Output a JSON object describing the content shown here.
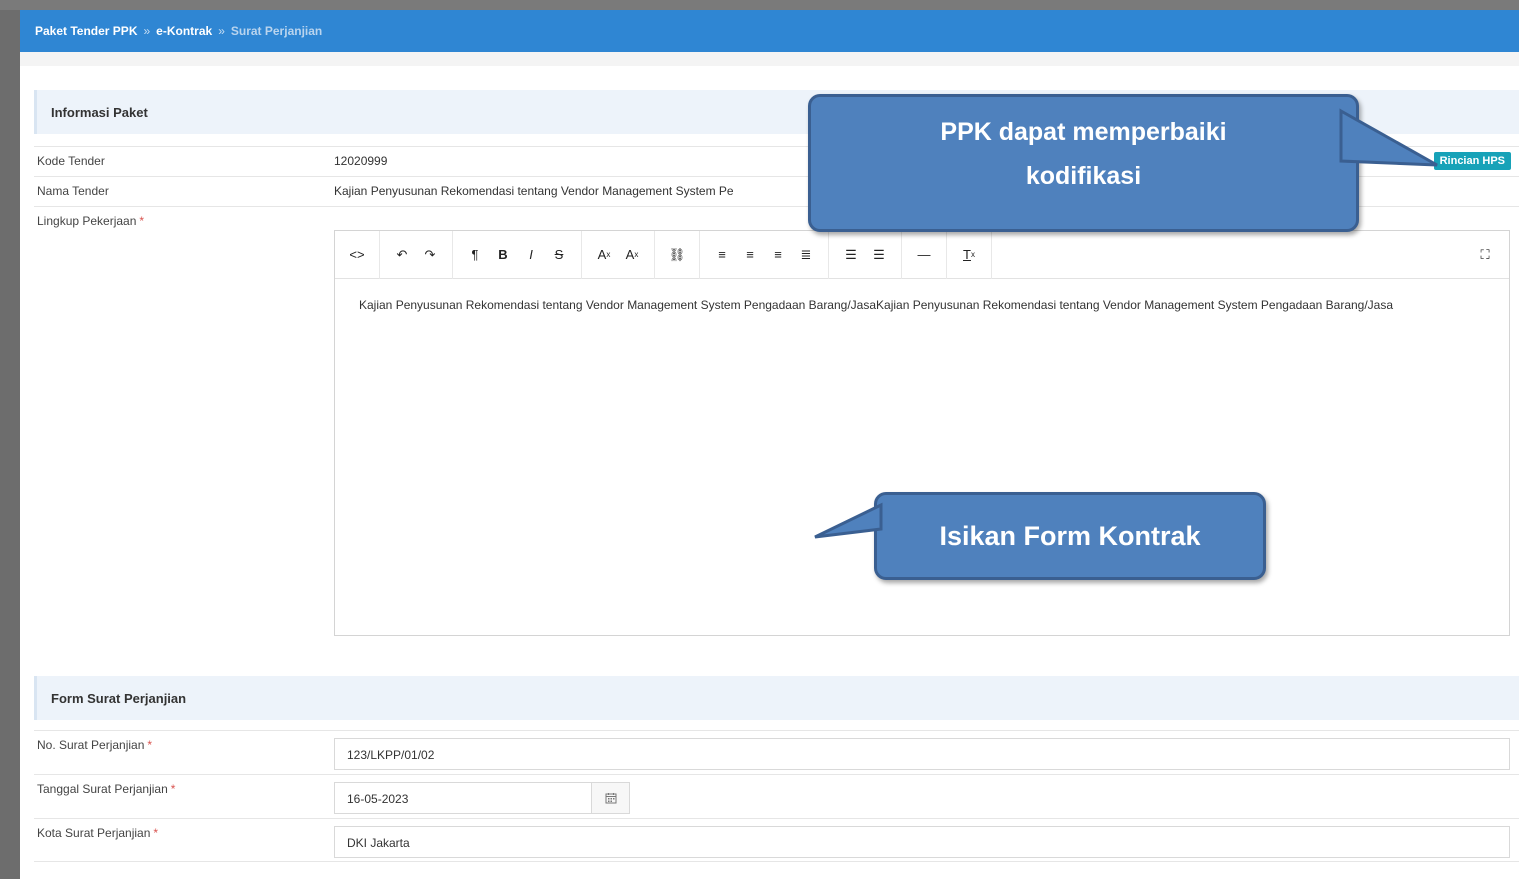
{
  "breadcrumb": {
    "item1": "Paket Tender PPK",
    "separator": "»",
    "item2": "e-Kontrak",
    "current": "Surat Perjanjian"
  },
  "informasi_paket": {
    "title": "Informasi Paket",
    "kode_tender_label": "Kode Tender",
    "kode_tender_value": "12020999",
    "rincian_hps_label": "Rincian HPS",
    "nama_tender_label": "Nama Tender",
    "nama_tender_value": "Kajian Penyusunan Rekomendasi tentang Vendor Management System Pe",
    "lingkup_label": "Lingkup Pekerjaan",
    "required_mark": "*"
  },
  "editor": {
    "toolbar_icons": [
      "html-code-icon",
      "undo-icon",
      "redo-icon",
      "paragraph-icon",
      "bold-icon",
      "italic-icon",
      "strikethrough-icon",
      "superscript-icon",
      "subscript-icon",
      "link-icon",
      "align-left-icon",
      "align-center-icon",
      "align-right-icon",
      "align-justify-icon",
      "unordered-list-icon",
      "ordered-list-icon",
      "horizontal-rule-icon",
      "clear-format-icon",
      "fullscreen-icon"
    ],
    "content": "Kajian Penyusunan Rekomendasi tentang Vendor Management System Pengadaan Barang/JasaKajian Penyusunan Rekomendasi tentang Vendor Management System Pengadaan Barang/Jasa"
  },
  "form_surat": {
    "title": "Form Surat Perjanjian",
    "no_surat_label": "No. Surat Perjanjian",
    "no_surat_value": "123/LKPP/01/02",
    "tanggal_label": "Tanggal Surat Perjanjian",
    "tanggal_value": "16-05-2023",
    "kota_label": "Kota Surat Perjanjian",
    "kota_value": "DKI Jakarta"
  },
  "callouts": {
    "top_line1": "PPK dapat memperbaiki",
    "top_line2": "kodifikasi",
    "bottom": "Isikan Form Kontrak"
  },
  "colors": {
    "header_blue": "#2f86d3",
    "callout_blue": "#4f81bd",
    "hps_teal": "#17a2b8",
    "required_red": "#d9534f"
  }
}
